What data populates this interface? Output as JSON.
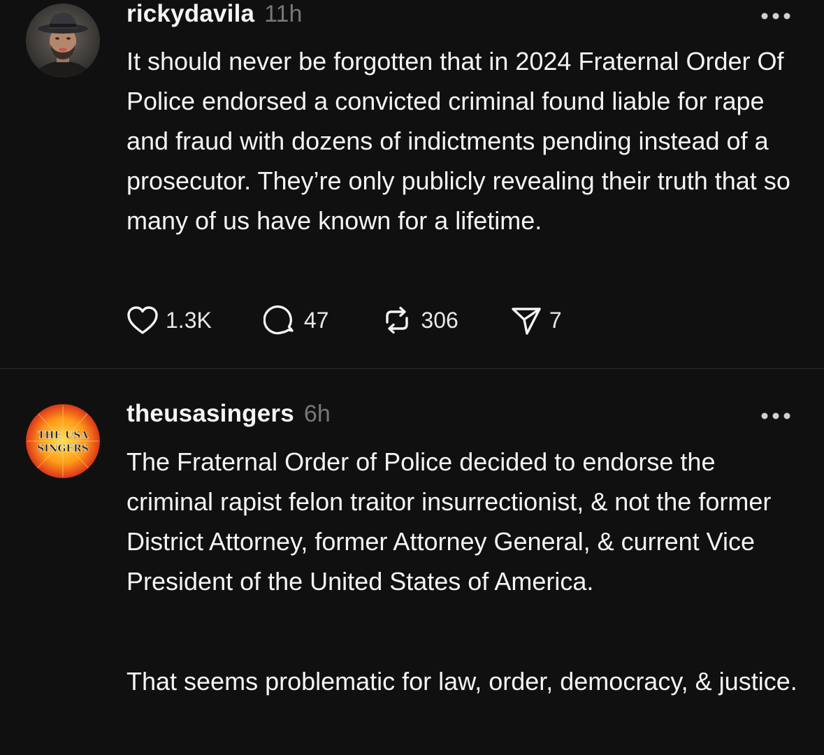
{
  "posts": [
    {
      "username": "rickydavila",
      "time": "11h",
      "avatar_icon": "user-avatar",
      "text": "It should never be forgotten that in 2024 Fraternal Order Of Police endorsed a convicted criminal found liable for rape and fraud with dozens of indictments pending instead of a prosecutor. They’re only publicly revealing their truth that so many of us have known for a lifetime.",
      "actions": {
        "likes": "1.3K",
        "replies": "47",
        "reposts": "306",
        "shares": "7"
      }
    },
    {
      "username": "theusasingers",
      "time": "6h",
      "avatar_text_line1": "THE USA",
      "avatar_text_line2": "SINGERS",
      "paragraphs": [
        "The Fraternal Order of Police decided to endorse the criminal rapist felon traitor insurrectionist, & not the former District Attorney, former Attorney General, & current Vice President of the United States of America.",
        "That seems problematic for law, order, democracy, & justice."
      ]
    }
  ],
  "colors": {
    "background": "#101010",
    "text": "#f3f5f7",
    "secondary": "#777777",
    "divider": "#2e2e2e"
  }
}
